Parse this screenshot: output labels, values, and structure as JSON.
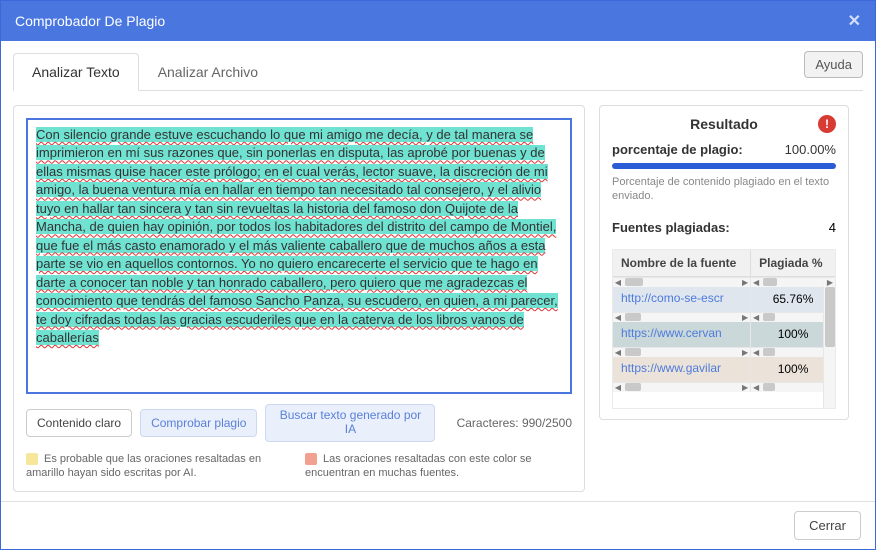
{
  "header": {
    "title": "Comprobador De Plagio"
  },
  "buttons": {
    "help": "Ayuda",
    "close": "Cerrar"
  },
  "tabs": {
    "text": "Analizar Texto",
    "file": "Analizar Archivo"
  },
  "editor": {
    "text": "Con silencio grande estuve escuchando lo que mi amigo me decía, y de tal manera se imprimieron en mí sus razones que, sin ponerlas en disputa, las aprobé por buenas y de ellas mismas quise hacer este prólogo; en el cual verás, lector suave, la discreción de mi amigo, la buena ventura mía en hallar en tiempo tan necesitado tal consejero, y el alivio tuyo en hallar tan sincera y tan sin revueltas la historia del famoso don Quijote de la Mancha, de quien hay opinión, por todos los habitadores del distrito del campo de Montiel, que fue el más casto enamorado y el más valiente caballero que de muchos años a esta parte se vio en aquellos contornos. Yo no quiero encarecerte el servicio que te hago en darte a conocer tan noble y tan honrado caballero, pero quiero que me agradezcas el conocimiento que tendrás del famoso Sancho Panza, su escudero, en quien, a mi parecer, te doy cifradas todas las gracias escuderiles que en la caterva de los libros vanos de caballerías",
    "counter": "Caracteres: 990/2500",
    "buttons": {
      "clear": "Contenido claro",
      "check": "Comprobar plagio",
      "ai": "Buscar texto generado por IA"
    },
    "legend": {
      "ai": "Es probable que las oraciones resaltadas en amarillo hayan sido escritas por AI.",
      "many": "Las oraciones resaltadas con este color se encuentran en muchas fuentes."
    }
  },
  "result": {
    "title": "Resultado",
    "pct_label": "porcentaje de plagio:",
    "pct_value": "100.00%",
    "pct_desc": "Porcentaje de contenido plagiado en el texto enviado.",
    "sources_label": "Fuentes plagiadas:",
    "sources_count": "4",
    "table": {
      "col_source": "Nombre de la fuente",
      "col_pct": "Plagiada %",
      "rows": [
        {
          "url": "http://como-se-escr",
          "pct": "65.76%"
        },
        {
          "url": "https://www.cervan",
          "pct": "100%"
        },
        {
          "url": "https://www.gavilar",
          "pct": "100%"
        }
      ]
    }
  }
}
